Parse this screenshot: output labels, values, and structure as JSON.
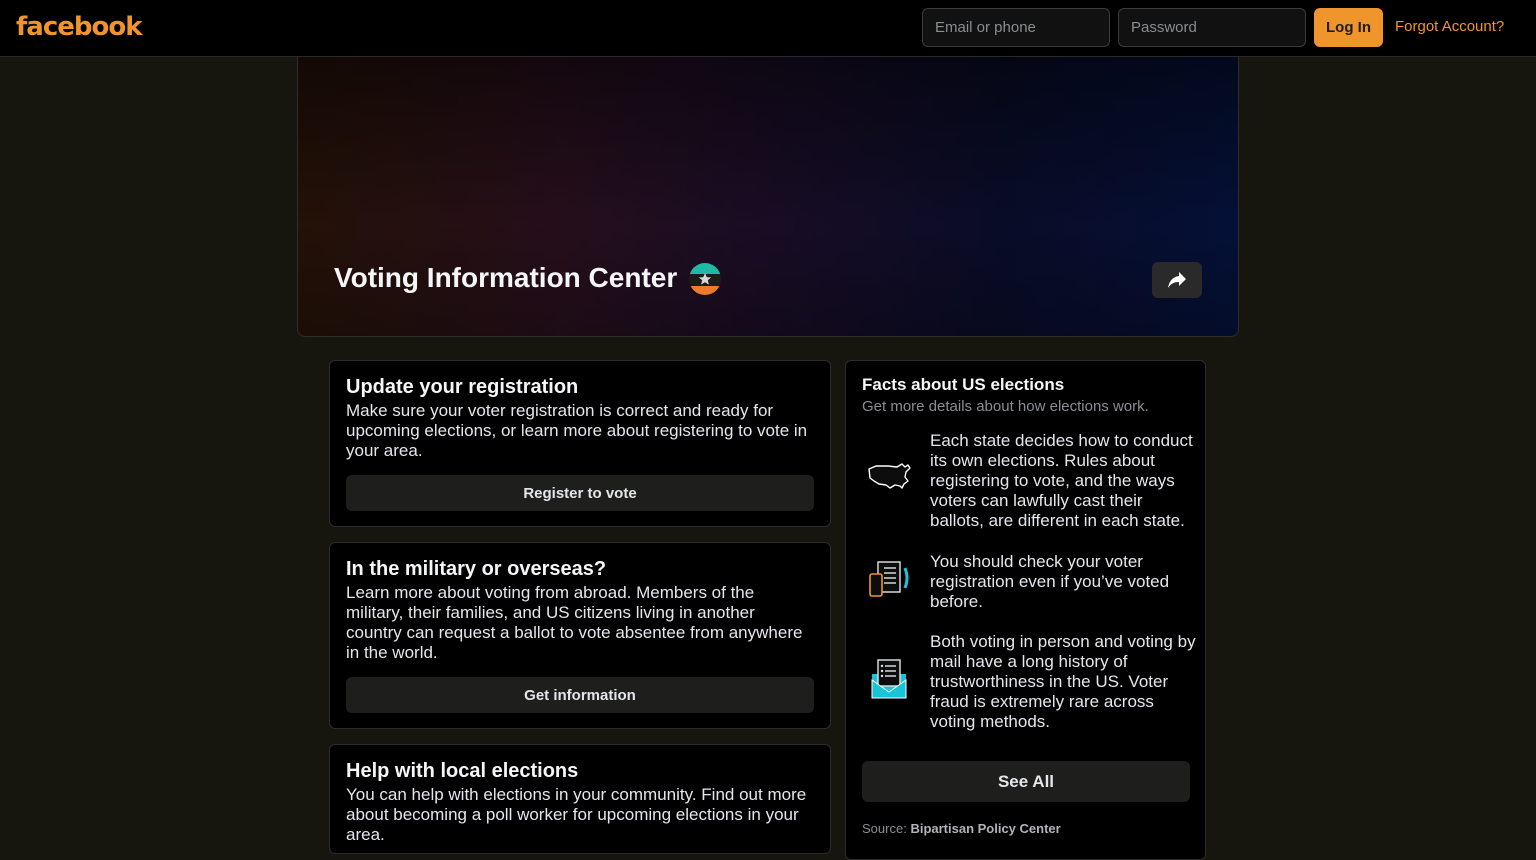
{
  "topbar": {
    "logo": "facebook",
    "email_placeholder": "Email or phone",
    "password_placeholder": "Password",
    "login_label": "Log In",
    "forgot_label": "Forgot Account?"
  },
  "cover": {
    "title": "Voting Information Center",
    "badge_icon": "ballot-badge-icon",
    "share_icon": "share-arrow-icon"
  },
  "cards": [
    {
      "title": "Update your registration",
      "body": "Make sure your voter registration is correct and ready for upcoming elections, or learn more about registering to vote in your area.",
      "button": "Register to vote"
    },
    {
      "title": "In the military or overseas?",
      "body": "Learn more about voting from abroad. Members of the military, their families, and US citizens living in another country can request a ballot to vote absentee from anywhere in the world.",
      "button": "Get information"
    },
    {
      "title": "Help with local elections",
      "body": "You can help with elections in your community. Find out more about becoming a poll worker for upcoming elections in your area."
    }
  ],
  "facts": {
    "title": "Facts about US elections",
    "subtitle": "Get more details about how elections work.",
    "items": [
      {
        "icon": "us-map-icon",
        "text": "Each state decides how to conduct its own elections. Rules about registering to vote, and the ways voters can lawfully cast their ballots, are different in each state."
      },
      {
        "icon": "phone-document-icon",
        "text": "You should check your voter registration even if you’ve voted before."
      },
      {
        "icon": "mail-ballot-icon",
        "text": "Both voting in person and voting by mail have a long history of trustworthiness in the US. Voter fraud is extremely rare across voting methods."
      }
    ],
    "see_all": "See All",
    "source_label": "Source:",
    "source_name": "Bipartisan Policy Center"
  },
  "colors": {
    "accent": "#f0952b",
    "background": "#16160f",
    "card": "#000000",
    "button": "#1e1e1c",
    "cyan": "#19c4d8"
  }
}
